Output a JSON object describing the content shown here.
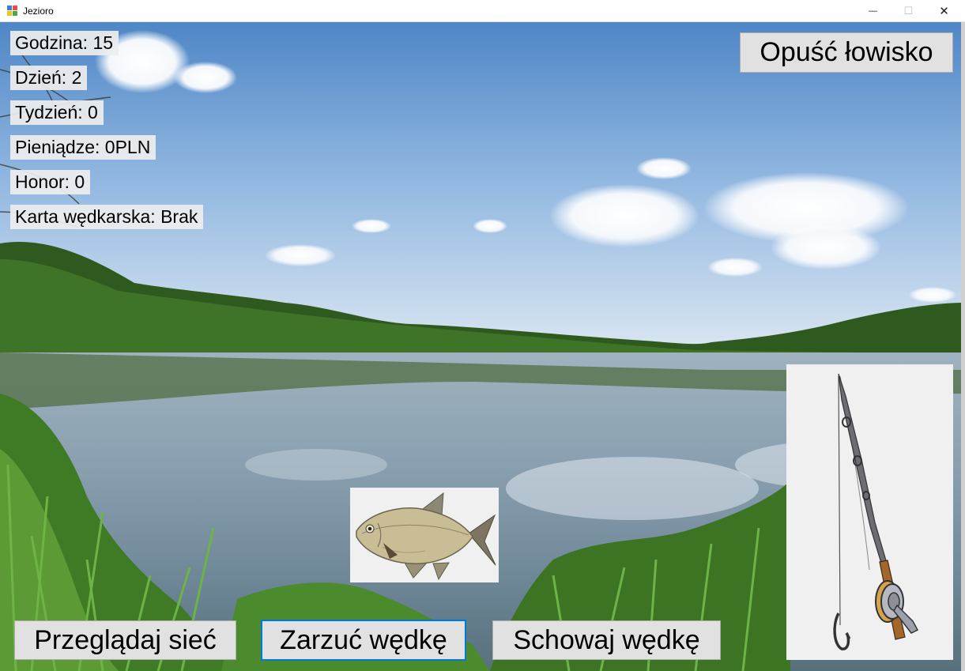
{
  "window": {
    "title": "Jezioro",
    "app_icon": "windows-form-icon",
    "minimize_glyph": "—",
    "maximize_glyph": "☐",
    "close_glyph": "✕"
  },
  "stats": {
    "hour": "Godzina: 15",
    "day": "Dzień: 2",
    "week": "Tydzień: 0",
    "money": "Pieniądze: 0PLN",
    "honor": "Honor: 0",
    "fishing_card": "Karta wędkarska: Brak"
  },
  "buttons": {
    "leave": "Opuść łowisko",
    "browse_net": "Przeglądaj sieć",
    "cast_rod": "Zarzuć wędkę",
    "hide_rod": "Schowaj wędkę"
  },
  "images": {
    "background": "lake-landscape",
    "fish": "bream-fish-icon",
    "rod": "fishing-rod-icon"
  }
}
